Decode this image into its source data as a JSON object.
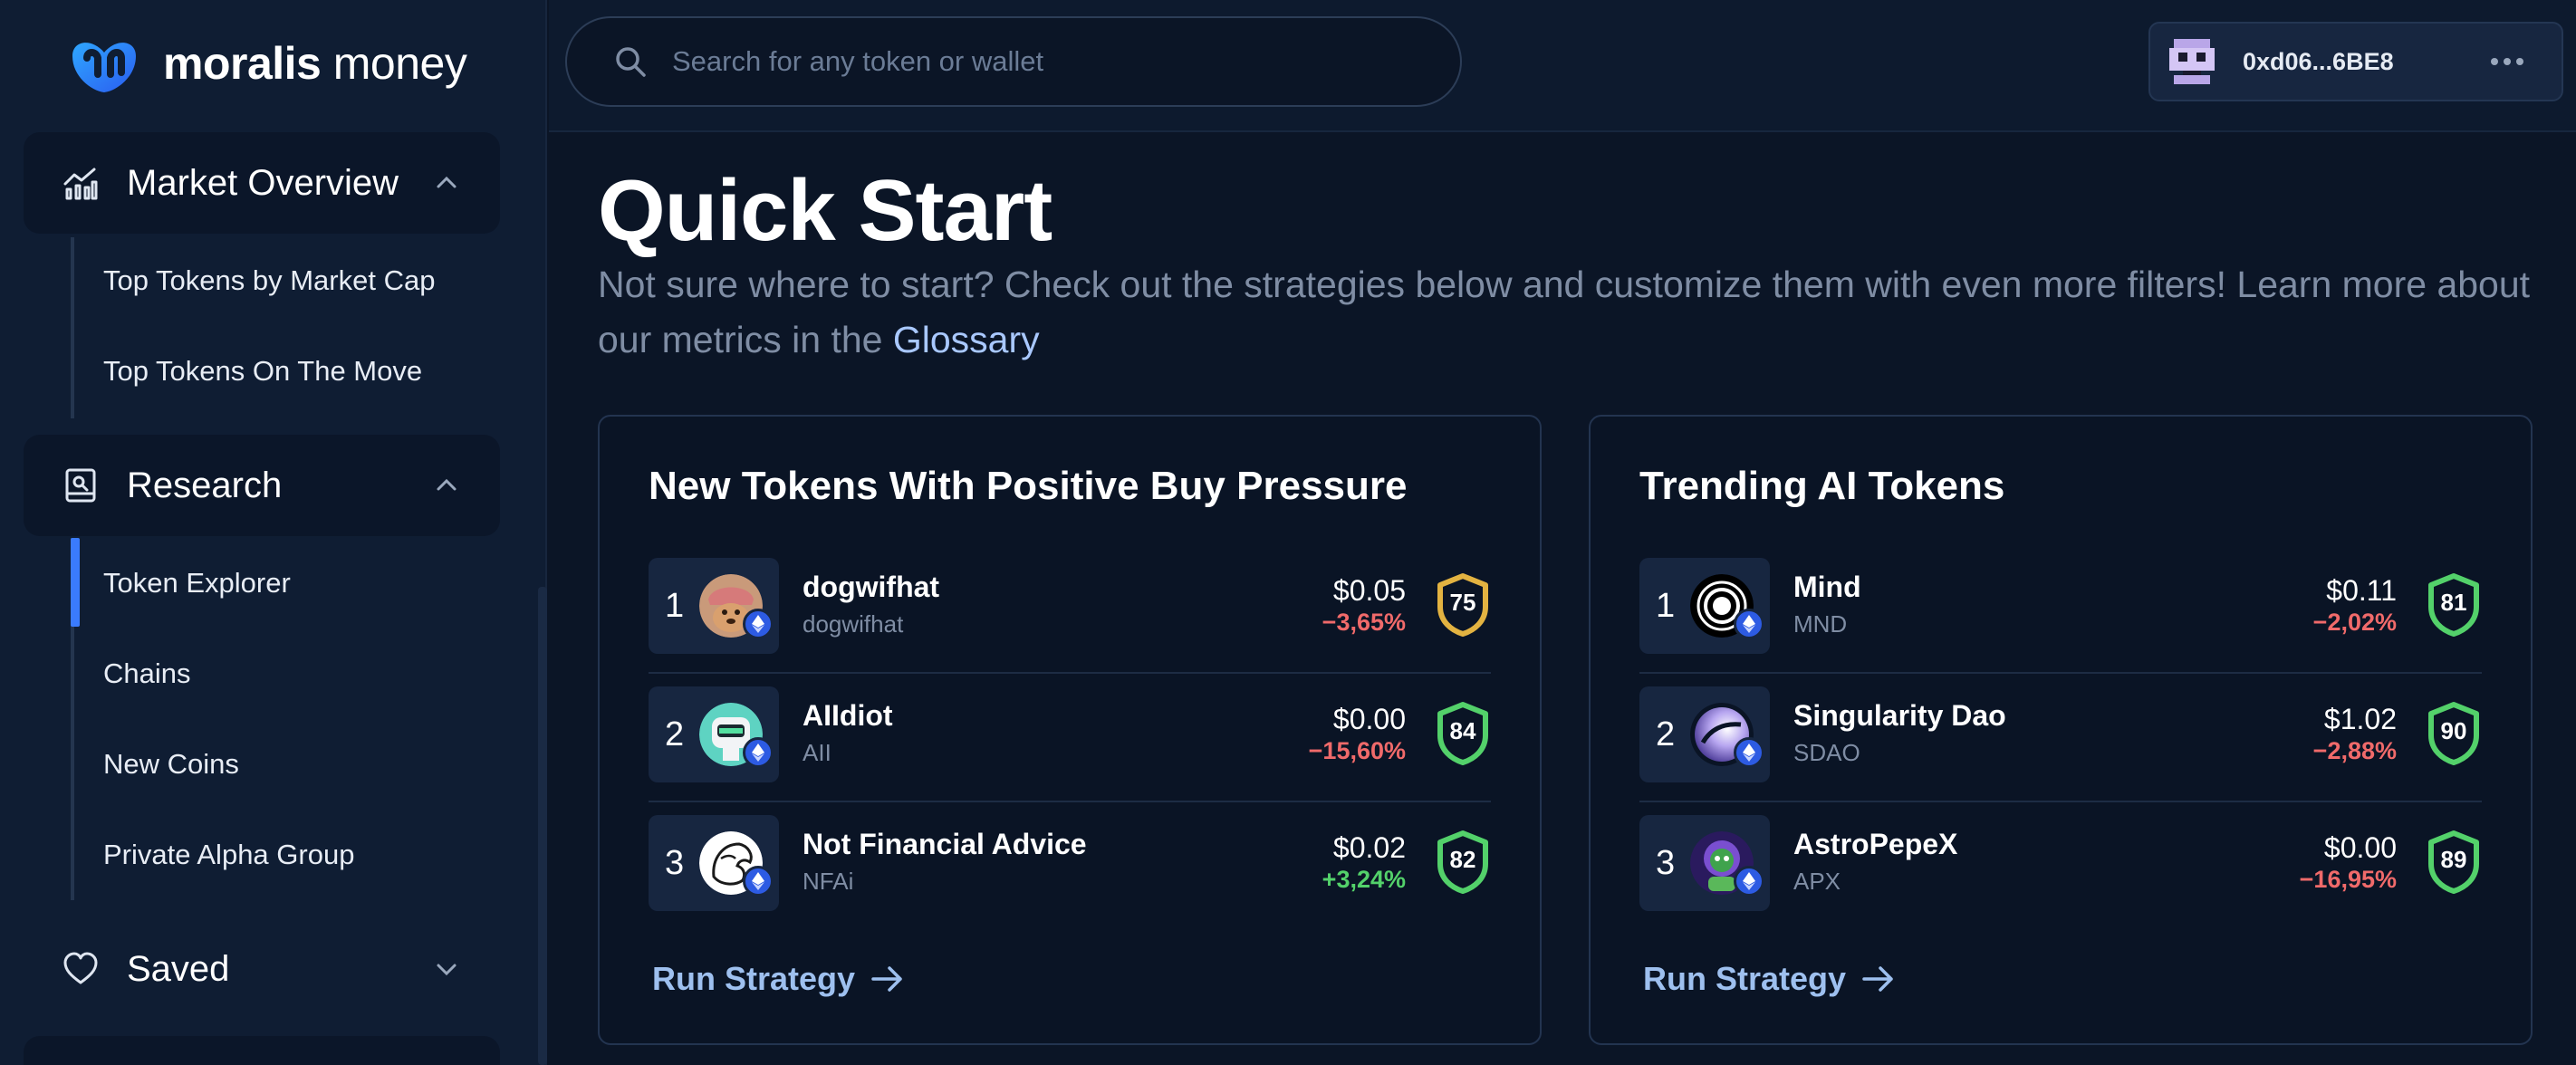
{
  "brand": {
    "bold": "moralis",
    "light": "money"
  },
  "search": {
    "placeholder": "Search for any token or wallet"
  },
  "wallet": {
    "address": "0xd06...6BE8"
  },
  "sidebar": {
    "market_overview": {
      "label": "Market Overview",
      "items": [
        "Top Tokens by Market Cap",
        "Top Tokens On The Move"
      ]
    },
    "research": {
      "label": "Research",
      "items": [
        "Token Explorer",
        "Chains",
        "New Coins",
        "Private Alpha Group"
      ],
      "active_item": "Token Explorer"
    },
    "saved": {
      "label": "Saved"
    }
  },
  "main": {
    "title": "Quick Start",
    "subtitle": "Not sure where to start? Check out the strategies below and customize them with even more filters! Learn more about our metrics in the",
    "glossary_link": "Glossary"
  },
  "cards": [
    {
      "title": "New Tokens With Positive Buy Pressure",
      "run_label": "Run Strategy",
      "tokens": [
        {
          "rank": "1",
          "name": "dogwifhat",
          "symbol": "dogwifhat",
          "price": "$0.05",
          "change": "−3,65%",
          "direction": "neg",
          "score": "75",
          "score_color": "#e3b341",
          "logo": "dog-avatar-icon"
        },
        {
          "rank": "2",
          "name": "AIIdiot",
          "symbol": "AII",
          "price": "$0.00",
          "change": "−15,60%",
          "direction": "neg",
          "score": "84",
          "score_color": "#53d16a",
          "logo": "robot-avatar-icon"
        },
        {
          "rank": "3",
          "name": "Not Financial Advice",
          "symbol": "NFAi",
          "price": "$0.02",
          "change": "+3,24%",
          "direction": "pos",
          "score": "82",
          "score_color": "#53d16a",
          "logo": "wolf-avatar-icon"
        }
      ]
    },
    {
      "title": "Trending AI Tokens",
      "run_label": "Run Strategy",
      "tokens": [
        {
          "rank": "1",
          "name": "Mind",
          "symbol": "MND",
          "price": "$0.11",
          "change": "−2,02%",
          "direction": "neg",
          "score": "81",
          "score_color": "#53d16a",
          "logo": "mind-ring-icon"
        },
        {
          "rank": "2",
          "name": "Singularity Dao",
          "symbol": "SDAO",
          "price": "$1.02",
          "change": "−2,88%",
          "direction": "neg",
          "score": "90",
          "score_color": "#53d16a",
          "logo": "singularity-orb-icon"
        },
        {
          "rank": "3",
          "name": "AstroPepeX",
          "symbol": "APX",
          "price": "$0.00",
          "change": "−16,95%",
          "direction": "neg",
          "score": "89",
          "score_color": "#53d16a",
          "logo": "astro-pepe-icon"
        }
      ]
    }
  ]
}
